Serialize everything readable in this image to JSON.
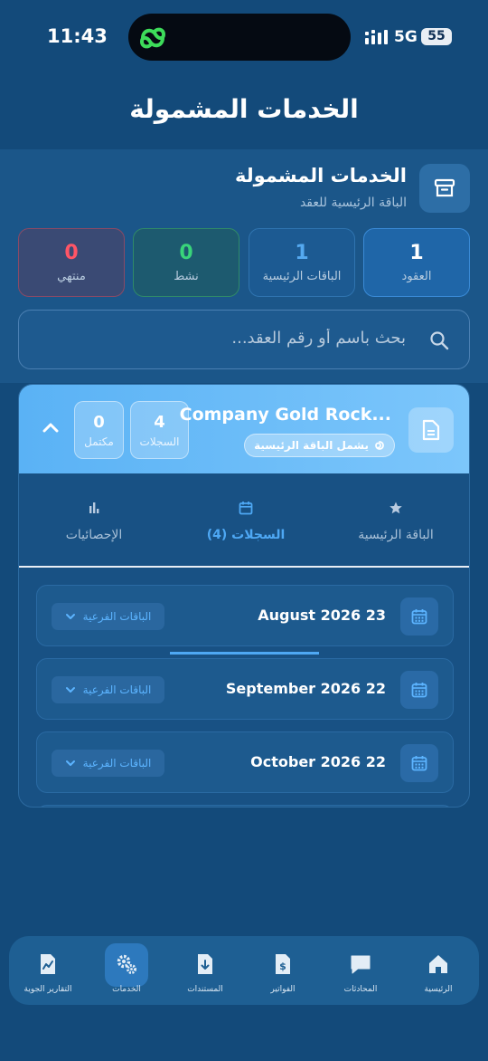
{
  "status_bar": {
    "time": "11:43",
    "network": "5G",
    "battery": "55"
  },
  "page_title": "الخدمات المشمولة",
  "header": {
    "title": "الخدمات المشمولة",
    "subtitle": "الباقة الرئيسية للعقد",
    "stats": [
      {
        "id": "contracts",
        "value": "1",
        "label": "العقود"
      },
      {
        "id": "main_plans",
        "value": "1",
        "label": "الباقات الرئيسية"
      },
      {
        "id": "active",
        "value": "0",
        "label": "نشط"
      },
      {
        "id": "expired",
        "value": "0",
        "label": "منتهي"
      }
    ],
    "search_placeholder": "بحث باسم أو رقم العقد...",
    "colors": {
      "contracts": "#ffffff",
      "main_plans": "#54a9f0",
      "active": "#39d47a",
      "expired": "#ff5566"
    }
  },
  "contract": {
    "title": "Company Gold Rock...",
    "badge": "يشمل الباقة الرئيسية",
    "records_count": "4",
    "records_label": "السجلات",
    "complete_count": "0",
    "complete_label": "مكتمل",
    "tabs": [
      {
        "label": "الباقة الرئيسية",
        "icon": "star-icon"
      },
      {
        "label": "السجلات (4)",
        "icon": "calendar-icon",
        "active": true
      },
      {
        "label": "الإحصائيات",
        "icon": "bar-chart-icon"
      }
    ],
    "records": [
      {
        "date": "August 2026 23",
        "button": "الباقات الفرعية"
      },
      {
        "date": "September 2026 22",
        "button": "الباقات الفرعية"
      },
      {
        "date": "October 2026 22",
        "button": "الباقات الفرعية"
      }
    ]
  },
  "bottom_nav": [
    {
      "label": "الرئيسية",
      "icon": "home-icon"
    },
    {
      "label": "المحادثات",
      "icon": "chat-icon"
    },
    {
      "label": "الفواتير",
      "icon": "invoice-icon"
    },
    {
      "label": "المستندات",
      "icon": "document-download-icon"
    },
    {
      "label": "الخدمات",
      "icon": "gears-icon",
      "active": true
    },
    {
      "label": "التقارير الجوية",
      "icon": "report-icon"
    }
  ]
}
